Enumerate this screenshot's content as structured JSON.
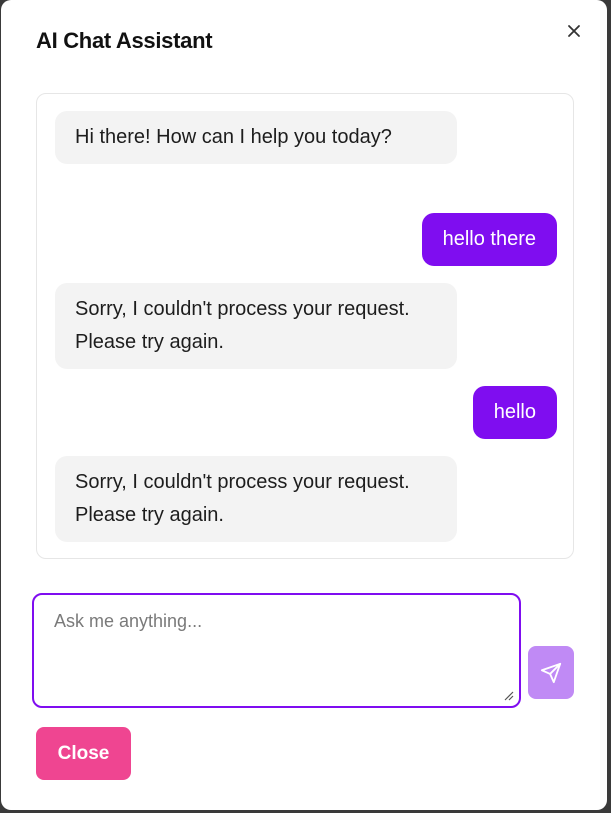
{
  "dialog": {
    "title": "AI Chat Assistant",
    "close_icon": "close-icon"
  },
  "messages": [
    {
      "role": "assistant",
      "text": "Hi there! How can I help you today?"
    },
    {
      "role": "user",
      "text": "hello there"
    },
    {
      "role": "assistant",
      "text": "Sorry, I couldn't process your request. Please try again."
    },
    {
      "role": "user",
      "text": "hello"
    },
    {
      "role": "assistant",
      "text": "Sorry, I couldn't process your request. Please try again."
    }
  ],
  "composer": {
    "placeholder": "Ask me anything...",
    "value": "",
    "send_icon": "send-icon"
  },
  "footer": {
    "close_label": "Close"
  },
  "colors": {
    "accent": "#7f0df0",
    "send_disabled": "#c08af5",
    "close_button": "#ef4591",
    "assistant_bubble": "#f3f3f3"
  }
}
